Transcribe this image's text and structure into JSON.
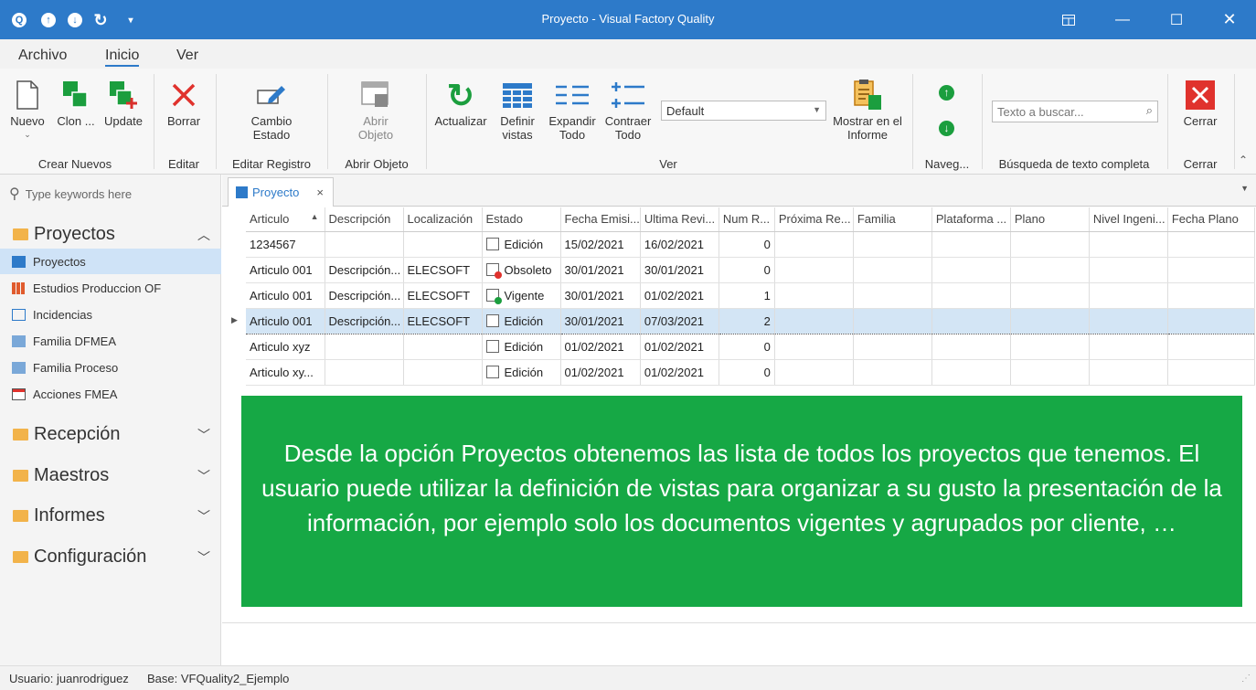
{
  "window": {
    "title": "Proyecto - Visual Factory Quality"
  },
  "menu": {
    "items": [
      "Archivo",
      "Inicio",
      "Ver"
    ]
  },
  "ribbon": {
    "nuevo": "Nuevo",
    "clon": "Clon ...",
    "update": "Update",
    "borrar": "Borrar",
    "cambio_estado": "Cambio Estado",
    "abrir_objeto": "Abrir Objeto",
    "actualizar": "Actualizar",
    "definir_vistas": "Definir vistas",
    "expandir_todo": "Expandir Todo",
    "contraer_todo": "Contraer Todo",
    "vista_combo": "Default",
    "mostrar_informe": "Mostrar en el Informe",
    "buscar_placeholder": "Texto a buscar...",
    "cerrar": "Cerrar",
    "groups": {
      "crear": "Crear Nuevos",
      "editar": "Editar",
      "editar_registro": "Editar Registro",
      "abrir_objeto": "Abrir Objeto",
      "ver": "Ver",
      "naveg": "Naveg...",
      "busqueda": "Búsqueda de texto completa",
      "cerrar": "Cerrar"
    }
  },
  "sidebar": {
    "search_placeholder": "Type keywords here",
    "proyectos_group": "Proyectos",
    "items": [
      "Proyectos",
      "Estudios Produccion OF",
      "Incidencias",
      "Familia DFMEA",
      "Familia Proceso",
      "Acciones FMEA"
    ],
    "recepcion": "Recepción",
    "maestros": "Maestros",
    "informes": "Informes",
    "configuracion": "Configuración"
  },
  "tab": {
    "label": "Proyecto"
  },
  "grid": {
    "columns": [
      "Articulo",
      "Descripción",
      "Localización",
      "Estado",
      "Fecha Emisi...",
      "Ultima Revi...",
      "Num R...",
      "Próxima Re...",
      "Familia",
      "Plataforma ...",
      "Plano",
      "Nivel Ingeni...",
      "Fecha Plano"
    ],
    "rows": [
      [
        "1234567",
        "",
        "",
        "Edición",
        "15/02/2021",
        "16/02/2021",
        "0"
      ],
      [
        "Articulo 001",
        "Descripción...",
        "ELECSOFT",
        "Obsoleto",
        "30/01/2021",
        "30/01/2021",
        "0"
      ],
      [
        "Articulo 001",
        "Descripción...",
        "ELECSOFT",
        "Vigente",
        "30/01/2021",
        "01/02/2021",
        "1"
      ],
      [
        "Articulo 001",
        "Descripción...",
        "ELECSOFT",
        "Edición",
        "30/01/2021",
        "07/03/2021",
        "2"
      ],
      [
        "Articulo xyz",
        "",
        "",
        "Edición",
        "01/02/2021",
        "01/02/2021",
        "0"
      ],
      [
        "Articulo xy...",
        "",
        "",
        "Edición",
        "01/02/2021",
        "01/02/2021",
        "0"
      ]
    ]
  },
  "callout": {
    "text": "Desde la opción Proyectos obtenemos las lista de todos los proyectos que tenemos. El usuario puede utilizar la definición de vistas para organizar a su gusto la presentación de la información, por ejemplo solo los documentos vigentes y agrupados por cliente, …"
  },
  "status": {
    "usuario": "Usuario: juanrodriguez",
    "base": "Base: VFQuality2_Ejemplo"
  }
}
